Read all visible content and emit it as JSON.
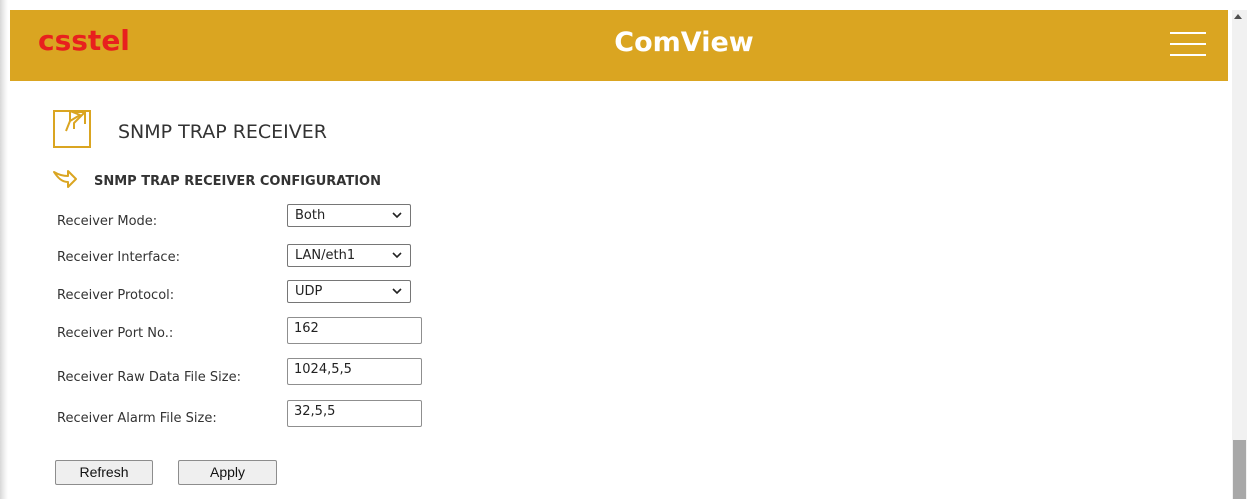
{
  "header": {
    "brand": "csstel",
    "title": "ComView",
    "menu_icon": "hamburger-menu-icon",
    "background_color": "#daa521",
    "brand_color": "#e8201e"
  },
  "page": {
    "title": "SNMP TRAP RECEIVER",
    "icon": "external-link-document-icon"
  },
  "section": {
    "title": "SNMP TRAP RECEIVER CONFIGURATION",
    "icon": "arrow-right-icon"
  },
  "form": {
    "receiver_mode": {
      "label": "Receiver Mode:",
      "value": "Both"
    },
    "receiver_interface": {
      "label": "Receiver Interface:",
      "value": "LAN/eth1"
    },
    "receiver_protocol": {
      "label": "Receiver Protocol:",
      "value": "UDP"
    },
    "receiver_port": {
      "label": "Receiver Port No.:",
      "value": "162"
    },
    "raw_data_file_size": {
      "label": "Receiver Raw Data File Size:",
      "value": "1024,5,5"
    },
    "alarm_file_size": {
      "label": "Receiver Alarm File Size:",
      "value": "32,5,5"
    }
  },
  "buttons": {
    "refresh": "Refresh",
    "apply": "Apply"
  }
}
